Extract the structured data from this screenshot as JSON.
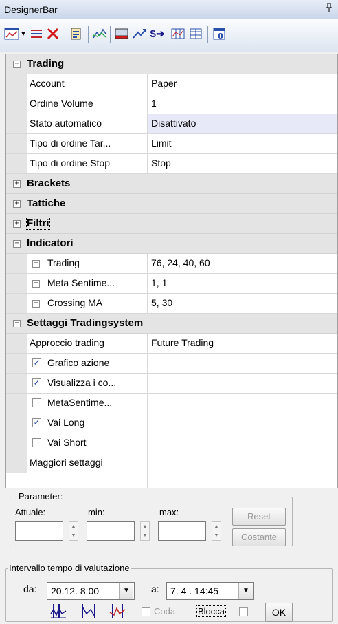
{
  "window": {
    "title": "DesignerBar",
    "pin_glyph": "ᵖ"
  },
  "toolbar": {
    "icons": [
      "chart-window-icon",
      "dropdown-arrow-icon",
      "indicator-list-icon",
      "delete-icon",
      "document-icon",
      "line-chart-icon",
      "monitor-icon",
      "trend-icon",
      "dollar-arrow-icon",
      "grid-chart-icon",
      "table-icon",
      "info-window-icon"
    ]
  },
  "grid": {
    "trading": {
      "title": "Trading",
      "expander": "−",
      "props": [
        {
          "name": "Account",
          "value": "Paper"
        },
        {
          "name": "Ordine Volume",
          "value": "1"
        },
        {
          "name": "Stato automatico",
          "value": "Disattivato"
        },
        {
          "name": "Tipo di ordine Tar...",
          "value": "Limit"
        },
        {
          "name": "Tipo di ordine Stop",
          "value": "Stop"
        }
      ]
    },
    "brackets": {
      "title": "Brackets",
      "expander": "+"
    },
    "tattiche": {
      "title": "Tattiche",
      "expander": "+"
    },
    "filtri": {
      "title": "Filtri",
      "expander": "+"
    },
    "indicatori": {
      "title": "Indicatori",
      "expander": "−",
      "props": [
        {
          "name": "Trading",
          "value": "76, 24, 40, 60",
          "expander": "+"
        },
        {
          "name": "Meta Sentime...",
          "value": "1, 1",
          "expander": "+"
        },
        {
          "name": "Crossing MA",
          "value": "5, 30",
          "expander": "+"
        }
      ]
    },
    "settaggi": {
      "title": "Settaggi Tradingsystem",
      "expander": "−",
      "approccio": {
        "name": "Approccio trading",
        "value": "Future Trading"
      },
      "checks": [
        {
          "name": "Grafico azione",
          "checked": true,
          "mark": "✓"
        },
        {
          "name": "Visualizza i co...",
          "checked": true,
          "mark": "✓"
        },
        {
          "name": "MetaSentime...",
          "checked": false,
          "mark": ""
        },
        {
          "name": "Vai Long",
          "checked": true,
          "mark": "✓"
        },
        {
          "name": "Vai Short",
          "checked": false,
          "mark": ""
        }
      ],
      "maggiori": {
        "name": "Maggiori settaggi",
        "value": ""
      }
    }
  },
  "parameter": {
    "legend": "Parameter:",
    "attuale_label": "Attuale:",
    "min_label": "min:",
    "max_label": "max:",
    "attuale_value": "",
    "min_value": "",
    "max_value": "",
    "reset_label": "Reset",
    "costante_label": "Costante"
  },
  "intervallo": {
    "legend": "Intervallo tempo di valutazione",
    "da_label": "da:",
    "da_value": "20.12.  8:00",
    "a_label": "a:",
    "a_value": "7. 4 . 14:45",
    "coda_label": "Coda",
    "coda_checked": false,
    "blocca_label": "Blocca",
    "blocca_checked": false,
    "ok_label": "OK"
  },
  "colors": {
    "accent": "#2a4fa8",
    "header_bg": "#c9d6ea",
    "category_bg": "#e4e4e4",
    "highlight_bg": "#e7e9f8"
  }
}
